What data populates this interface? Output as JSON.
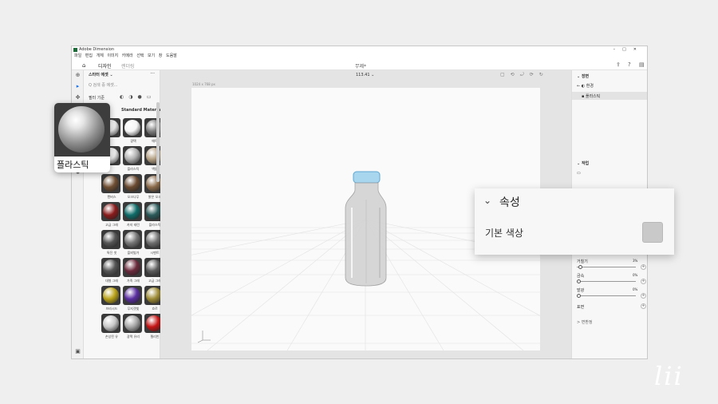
{
  "window": {
    "title": "Adobe Dimension",
    "controls": [
      "–",
      "□",
      "✕"
    ],
    "menu": [
      "파일",
      "편집",
      "개체",
      "이미지",
      "카메라",
      "선택",
      "보기",
      "창",
      "도움말"
    ],
    "tabs": [
      "디자인",
      "렌더링"
    ],
    "document": "무제*",
    "brand_color": "#1e6b3a"
  },
  "assets_panel": {
    "header": "스타터 에셋 ⌄",
    "search_placeholder": "Q  검색 중 에셋...",
    "filter_label": "필터 기준",
    "section": "Standard Materia...",
    "materials": [
      {
        "label": "",
        "tone": "#e9e9e9"
      },
      {
        "label": "광택",
        "tone": "#f6f6f6"
      },
      {
        "label": "매트",
        "tone": "#7d7d7d"
      },
      {
        "label": "",
        "tone": "#e9e9e9"
      },
      {
        "label": "플라스틱",
        "tone": "#b0b0b0"
      },
      {
        "label": "벽돌",
        "tone": "#b39f82"
      },
      {
        "label": "캔버스",
        "tone": "#6f4f33"
      },
      {
        "label": "오크나무",
        "tone": "#6a4a30"
      },
      {
        "label": "밝은 오크",
        "tone": "#8a6a4a"
      },
      {
        "label": "고급 그레",
        "tone": "#8a1c1c"
      },
      {
        "label": "카지 테린",
        "tone": "#0f6c69"
      },
      {
        "label": "플라스틱",
        "tone": "#2b5a5a"
      },
      {
        "label": "특진 셋",
        "tone": "#555555"
      },
      {
        "label": "플뫼빛가",
        "tone": "#777777"
      },
      {
        "label": "시멘트",
        "tone": "#6f6f6f"
      },
      {
        "label": "대형 그레",
        "tone": "#565656"
      },
      {
        "label": "가죽 그레",
        "tone": "#6b2b3d"
      },
      {
        "label": "고급 그레",
        "tone": "#5c5c5c"
      },
      {
        "label": "브라시드",
        "tone": "#b9a21a"
      },
      {
        "label": "무지갯빛",
        "tone": "#5a2ea0"
      },
      {
        "label": "흐르",
        "tone": "#9c8a34"
      },
      {
        "label": "손상된 유",
        "tone": "#c8c8c8"
      },
      {
        "label": "광택 유리",
        "tone": "#a8a8a8"
      },
      {
        "label": "젤리빈",
        "tone": "#c41414"
      }
    ]
  },
  "viewport": {
    "zoom": "113.41 ⌄",
    "dims": "1024 x 768 px"
  },
  "scene_panel": {
    "section": "장면",
    "environment": "← ◐ 환경",
    "object": "플라스틱"
  },
  "actions_panel": {
    "section": "작업"
  },
  "properties_panel": {
    "sliders": [
      {
        "label": "거칠기",
        "value": "3%",
        "fraction": 0.03
      },
      {
        "label": "금속",
        "value": "0%",
        "fraction": 0.0
      },
      {
        "label": "발광",
        "value": "0%",
        "fraction": 0.0
      }
    ],
    "bump_label": "표면",
    "transform_label": "변형 · 변환",
    "transform_value": "> 변환정"
  },
  "zoom_card": {
    "label": "플라스틱"
  },
  "properties_card": {
    "title": "속성",
    "field": "기본 색상",
    "swatch_color": "#c9c9c9"
  }
}
